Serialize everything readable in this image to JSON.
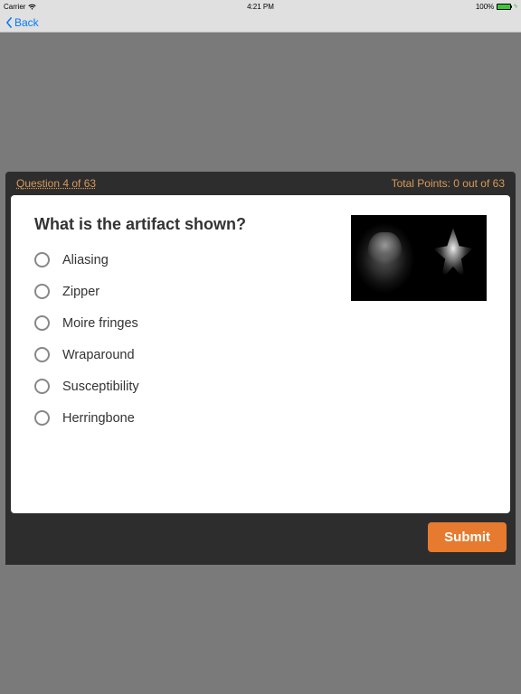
{
  "statusbar": {
    "carrier": "Carrier",
    "time": "4:21 PM",
    "battery_pct": "100%"
  },
  "nav": {
    "back_label": "Back"
  },
  "quiz": {
    "progress": "Question 4 of 63",
    "points": "Total Points: 0 out of 63",
    "question": "What is the artifact shown?",
    "options": [
      "Aliasing",
      "Zipper",
      "Moire fringes",
      "Wraparound",
      "Susceptibility",
      "Herringbone"
    ],
    "submit_label": "Submit"
  }
}
